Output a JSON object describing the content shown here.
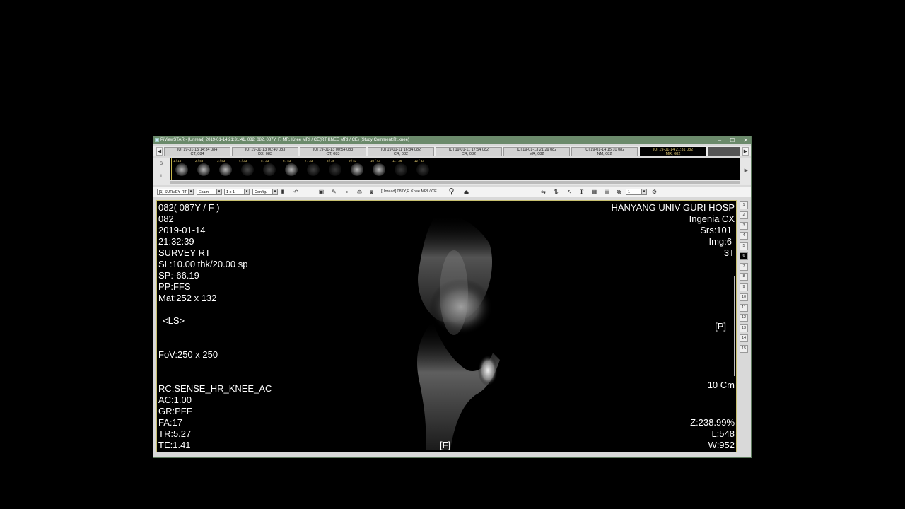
{
  "window": {
    "title": "PiViewSTAR - [Unread] 2019-01-14 21:31:41, 082, 082, 087Y, F, MR, Knee MRI / CE(RT KNEE MRI / CE)  (Study Comment:Rt.knee)",
    "minimize": "–",
    "maximize": "☐",
    "close": "✕"
  },
  "study_tabs": {
    "prev": "◀",
    "next": "▶",
    "items": [
      {
        "line1": "[U] 19-01-15 14:34  084",
        "line2": "CT, 084"
      },
      {
        "line1": "[U] 19-01-13 00:40  083",
        "line2": "DX, 083"
      },
      {
        "line1": "[U] 19-01-13 00:54  083",
        "line2": "CT, 083"
      },
      {
        "line1": "[U] 19-01-11 16:34  082",
        "line2": "CR, 082"
      },
      {
        "line1": "[U] 19-01-11 17:54  082",
        "line2": "CR, 082"
      },
      {
        "line1": "[U] 19-01-13 21:29  082",
        "line2": "MR, 082"
      },
      {
        "line1": "[U] 19-01-14 15:10  082",
        "line2": "NM, 082"
      },
      {
        "line1": "[U] 19-01-14 21:31  082",
        "line2": "MR, 082"
      }
    ]
  },
  "thumbnails": {
    "side_top": "S",
    "side_bottom": "I",
    "items": [
      {
        "label": "1 / 16"
      },
      {
        "label": "2 / 43"
      },
      {
        "label": "3 / 43"
      },
      {
        "label": "4 / 33"
      },
      {
        "label": "5 / 33"
      },
      {
        "label": "6 / 43"
      },
      {
        "label": "7 / 33"
      },
      {
        "label": "8 / 36"
      },
      {
        "label": "9 / 43"
      },
      {
        "label": "10 / 43"
      },
      {
        "label": "11 / 36"
      },
      {
        "label": "12 / 33"
      }
    ]
  },
  "toolbar": {
    "series_select": "[1] SURVEY RT",
    "exam_select": "Exam",
    "layout_select": "1 x 1",
    "config_select": "Config.",
    "status": "[Unread] 087Y,F, Knee MRI / CE",
    "frame_value": "1"
  },
  "overlay": {
    "patient_id": "082( 087Y / F )",
    "patient_no": "082",
    "date": "2019-01-14",
    "time": "21:32:39",
    "series": "SURVEY RT",
    "slice": "SL:10.00 thk/20.00 sp",
    "sp": "SP:-66.19",
    "pp": "PP:FFS",
    "matrix": "Mat:252 x 132",
    "orientation_left": "<LS>",
    "fov": "FoV:250 x 250",
    "rc": "RC:SENSE_HR_KNEE_AC",
    "ac": "AC:1.00",
    "gr": "GR:PFF",
    "fa": "FA:17",
    "tr": "TR:5.27",
    "te": "TE:1.41",
    "orientation_bottom": "[F]",
    "hospital": "HANYANG UNIV GURI HOSP",
    "device": "Ingenia CX",
    "srs": "Srs:101",
    "img": "Img:6",
    "field": "3T",
    "orientation_right": "[P]",
    "scale": "10 Cm",
    "zoom": "Z:238.99%",
    "level": "L:548",
    "width": "W:952"
  },
  "image_numbers": [
    "1",
    "2",
    "3",
    "4",
    "5",
    "6",
    "7",
    "8",
    "9",
    "10",
    "11",
    "12",
    "13",
    "14",
    "15"
  ],
  "active_image_index": 5
}
